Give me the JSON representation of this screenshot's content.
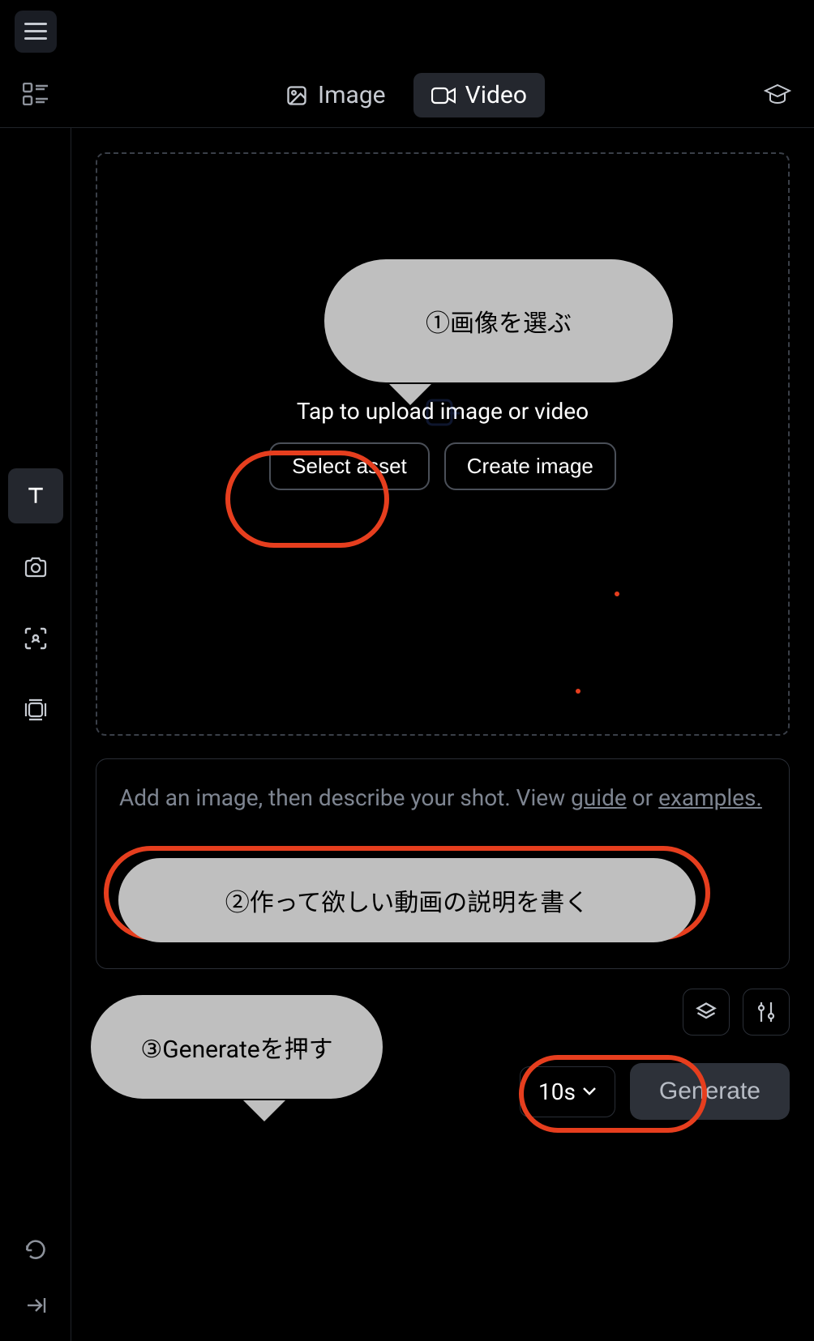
{
  "topbar": {},
  "tabs": {
    "image_label": "Image",
    "video_label": "Video",
    "active": "video"
  },
  "sidebar": {
    "items": [
      {
        "name": "text-icon",
        "active": true
      },
      {
        "name": "camera-icon",
        "active": false
      },
      {
        "name": "focus-icon",
        "active": false
      },
      {
        "name": "layers-square-icon",
        "active": false
      }
    ],
    "bottom": [
      {
        "name": "refresh-icon"
      },
      {
        "name": "collapse-right-icon"
      }
    ]
  },
  "dropzone": {
    "upload_text": "Tap to upload image or video",
    "select_asset_label": "Select asset",
    "create_image_label": "Create image"
  },
  "prompt": {
    "placeholder_prefix": "Add an image, then describe your shot. View ",
    "guide_link": "guide",
    "placeholder_mid": " or ",
    "examples_link": "examples."
  },
  "bottombar": {
    "duration_label": "10s",
    "generate_label": "Generate"
  },
  "annotations": {
    "step1": "①画像を選ぶ",
    "step2": "②作って欲しい動画の説明を書く",
    "step3": "③Generateを押す"
  },
  "colors": {
    "bg": "#000000",
    "panel": "#1a1d24",
    "border": "#2a2e36",
    "text_muted": "#7e8591",
    "highlight": "#e63e1e",
    "callout_bg": "#bfbfbf"
  }
}
